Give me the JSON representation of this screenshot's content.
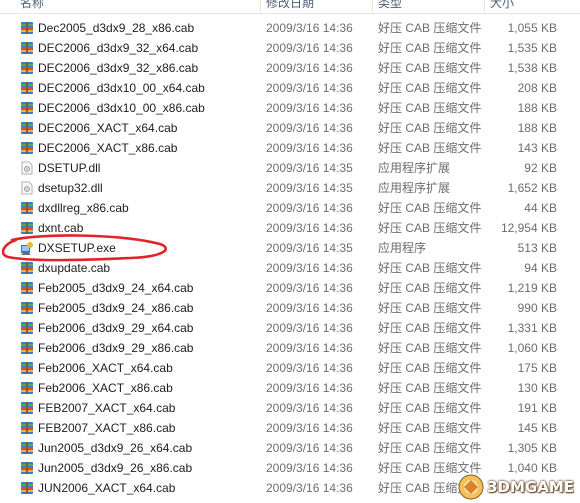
{
  "columns": {
    "name": "名称",
    "date": "修改日期",
    "type": "类型",
    "size": "大小"
  },
  "files": [
    {
      "name": "Dec2005_d3dx9_28_x86.cab",
      "date": "2009/3/16 14:36",
      "type": "好压 CAB 压缩文件",
      "size": "1,055 KB",
      "icon": "cab-archive-icon"
    },
    {
      "name": "DEC2006_d3dx9_32_x64.cab",
      "date": "2009/3/16 14:36",
      "type": "好压 CAB 压缩文件",
      "size": "1,535 KB",
      "icon": "cab-archive-icon"
    },
    {
      "name": "DEC2006_d3dx9_32_x86.cab",
      "date": "2009/3/16 14:36",
      "type": "好压 CAB 压缩文件",
      "size": "1,538 KB",
      "icon": "cab-archive-icon"
    },
    {
      "name": "DEC2006_d3dx10_00_x64.cab",
      "date": "2009/3/16 14:36",
      "type": "好压 CAB 压缩文件",
      "size": "208 KB",
      "icon": "cab-archive-icon"
    },
    {
      "name": "DEC2006_d3dx10_00_x86.cab",
      "date": "2009/3/16 14:36",
      "type": "好压 CAB 压缩文件",
      "size": "188 KB",
      "icon": "cab-archive-icon"
    },
    {
      "name": "DEC2006_XACT_x64.cab",
      "date": "2009/3/16 14:36",
      "type": "好压 CAB 压缩文件",
      "size": "188 KB",
      "icon": "cab-archive-icon"
    },
    {
      "name": "DEC2006_XACT_x86.cab",
      "date": "2009/3/16 14:36",
      "type": "好压 CAB 压缩文件",
      "size": "143 KB",
      "icon": "cab-archive-icon"
    },
    {
      "name": "DSETUP.dll",
      "date": "2009/3/16 14:35",
      "type": "应用程序扩展",
      "size": "92 KB",
      "icon": "dll-file-icon"
    },
    {
      "name": "dsetup32.dll",
      "date": "2009/3/16 14:35",
      "type": "应用程序扩展",
      "size": "1,652 KB",
      "icon": "dll-file-icon"
    },
    {
      "name": "dxdllreg_x86.cab",
      "date": "2009/3/16 14:36",
      "type": "好压 CAB 压缩文件",
      "size": "44 KB",
      "icon": "cab-archive-icon"
    },
    {
      "name": "dxnt.cab",
      "date": "2009/3/16 14:36",
      "type": "好压 CAB 压缩文件",
      "size": "12,954 KB",
      "icon": "cab-archive-icon"
    },
    {
      "name": "DXSETUP.exe",
      "date": "2009/3/16 14:35",
      "type": "应用程序",
      "size": "513 KB",
      "icon": "setup-exe-icon"
    },
    {
      "name": "dxupdate.cab",
      "date": "2009/3/16 14:36",
      "type": "好压 CAB 压缩文件",
      "size": "94 KB",
      "icon": "cab-archive-icon"
    },
    {
      "name": "Feb2005_d3dx9_24_x64.cab",
      "date": "2009/3/16 14:36",
      "type": "好压 CAB 压缩文件",
      "size": "1,219 KB",
      "icon": "cab-archive-icon"
    },
    {
      "name": "Feb2005_d3dx9_24_x86.cab",
      "date": "2009/3/16 14:36",
      "type": "好压 CAB 压缩文件",
      "size": "990 KB",
      "icon": "cab-archive-icon"
    },
    {
      "name": "Feb2006_d3dx9_29_x64.cab",
      "date": "2009/3/16 14:36",
      "type": "好压 CAB 压缩文件",
      "size": "1,331 KB",
      "icon": "cab-archive-icon"
    },
    {
      "name": "Feb2006_d3dx9_29_x86.cab",
      "date": "2009/3/16 14:36",
      "type": "好压 CAB 压缩文件",
      "size": "1,060 KB",
      "icon": "cab-archive-icon"
    },
    {
      "name": "Feb2006_XACT_x64.cab",
      "date": "2009/3/16 14:36",
      "type": "好压 CAB 压缩文件",
      "size": "175 KB",
      "icon": "cab-archive-icon"
    },
    {
      "name": "Feb2006_XACT_x86.cab",
      "date": "2009/3/16 14:36",
      "type": "好压 CAB 压缩文件",
      "size": "130 KB",
      "icon": "cab-archive-icon"
    },
    {
      "name": "FEB2007_XACT_x64.cab",
      "date": "2009/3/16 14:36",
      "type": "好压 CAB 压缩文件",
      "size": "191 KB",
      "icon": "cab-archive-icon"
    },
    {
      "name": "FEB2007_XACT_x86.cab",
      "date": "2009/3/16 14:36",
      "type": "好压 CAB 压缩文件",
      "size": "145 KB",
      "icon": "cab-archive-icon"
    },
    {
      "name": "Jun2005_d3dx9_26_x64.cab",
      "date": "2009/3/16 14:36",
      "type": "好压 CAB 压缩文件",
      "size": "1,305 KB",
      "icon": "cab-archive-icon"
    },
    {
      "name": "Jun2005_d3dx9_26_x86.cab",
      "date": "2009/3/16 14:36",
      "type": "好压 CAB 压缩文件",
      "size": "1,040 KB",
      "icon": "cab-archive-icon"
    },
    {
      "name": "JUN2006_XACT_x64.cab",
      "date": "2009/3/16 14:36",
      "type": "好压 CAB 压缩文件",
      "size": "",
      "icon": "cab-archive-icon"
    }
  ],
  "highlight": {
    "row": 11,
    "color": "#e0242a"
  },
  "watermark": {
    "text": "3DMGAME"
  }
}
